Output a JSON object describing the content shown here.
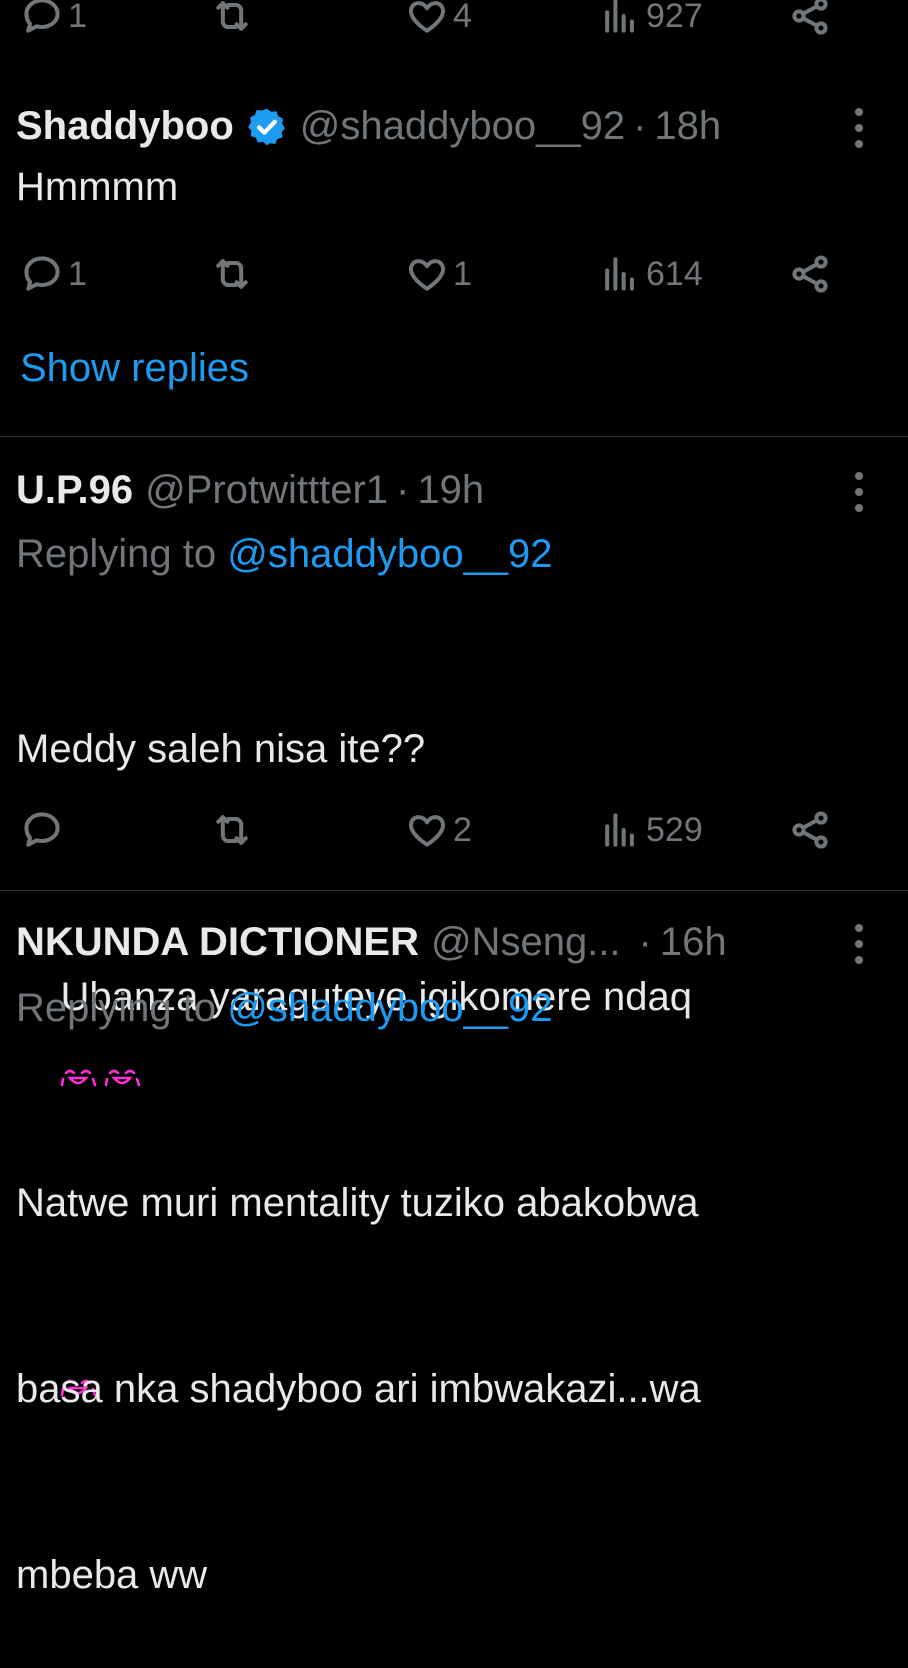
{
  "top_actions": {
    "replies": "1",
    "retweets": "",
    "likes": "4",
    "views": "927"
  },
  "post1": {
    "name": "Shaddyboo",
    "handle": "@shaddyboo__92",
    "dot": "·",
    "time": "18h",
    "text": "Hmmmm",
    "actions": {
      "replies": "1",
      "retweets": "",
      "likes": "1",
      "views": "614"
    },
    "show_replies": "Show replies"
  },
  "post2": {
    "name": "U.P.96",
    "handle": "@Protwittter1",
    "dot": "·",
    "time": "19h",
    "replying_prefix": "Replying to ",
    "replying_to": "@shaddyboo__92",
    "line1": "Meddy saleh nisa ite??",
    "line2": "Ubanza yaraguteye igikomere ndaq",
    "emoji": "crying-laughing-emoji",
    "actions": {
      "replies": "",
      "retweets": "",
      "likes": "2",
      "views": "529"
    }
  },
  "post3": {
    "name": "NKUNDA DICTIONER",
    "handle": "@Nseng...",
    "dot": "·",
    "time": "16h",
    "replying_prefix": "Replying to ",
    "replying_to": "@shaddyboo__92",
    "line1": "Natwe muri mentality tuziko abakobwa",
    "line2": "basa nka shadyboo ari imbwakazi...wa",
    "line3": "mbeba ww"
  },
  "colors": {
    "background": "#000000",
    "text": "#e7e9ea",
    "muted": "#71767b",
    "link": "#1d9bf0",
    "verified": "#1d9bf0",
    "divider": "#2f3336",
    "emoji": "#ff2fd6"
  }
}
